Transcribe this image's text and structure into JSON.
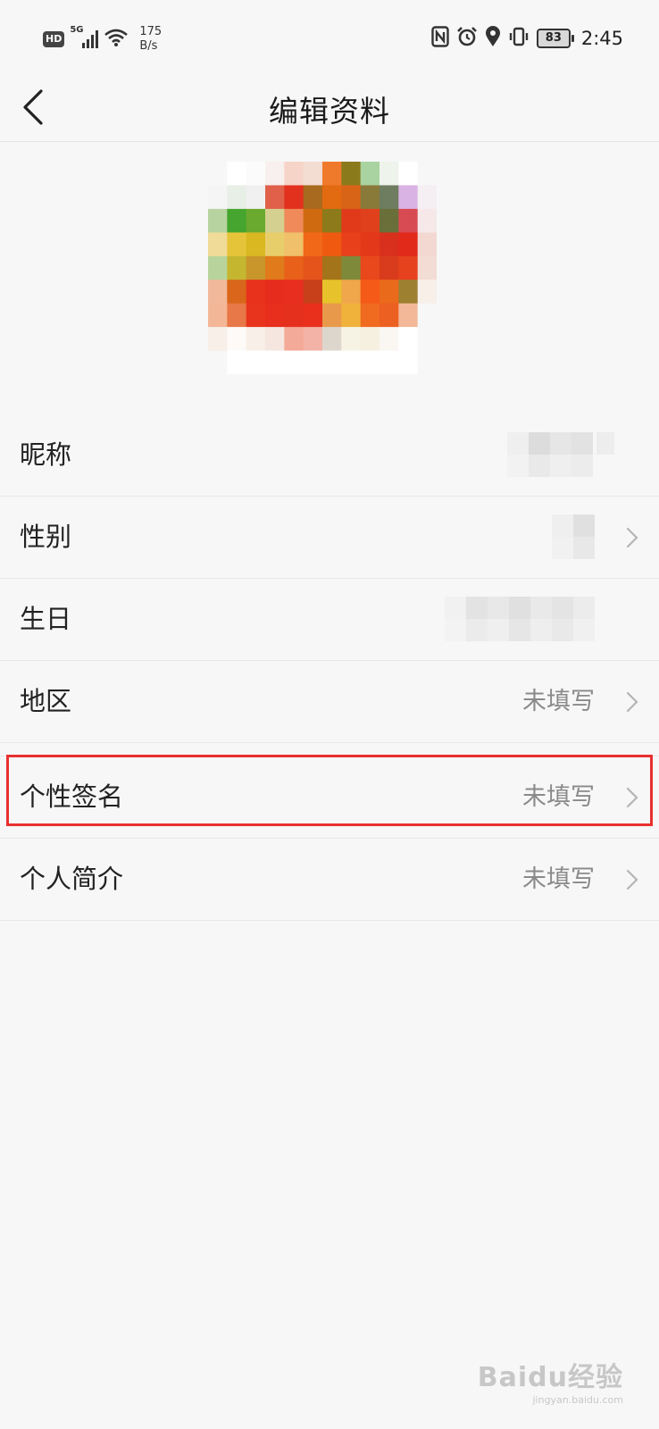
{
  "status_bar": {
    "hd": "HD",
    "signal_type": "5G",
    "net_speed_value": "175",
    "net_speed_unit": "B/s",
    "battery": "83",
    "time": "2:45"
  },
  "header": {
    "title": "编辑资料"
  },
  "profile_rows": [
    {
      "label": "昵称",
      "value": ""
    },
    {
      "label": "性别",
      "value": ""
    },
    {
      "label": "生日",
      "value": ""
    },
    {
      "label": "地区",
      "value": "未填写"
    },
    {
      "label": "个性签名",
      "value": "未填写"
    },
    {
      "label": "个人简介",
      "value": "未填写"
    }
  ],
  "highlight_color": "#e8312f",
  "watermark": {
    "text": "Baidu经验",
    "sub": "jingyan.baidu.com"
  }
}
